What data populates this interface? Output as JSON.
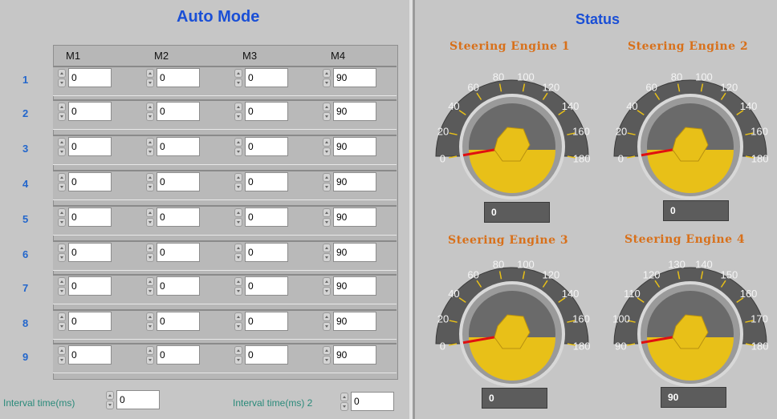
{
  "auto_mode": {
    "title": "Auto Mode",
    "columns": [
      "M1",
      "M2",
      "M3",
      "M4"
    ],
    "rows": [
      {
        "label": "1",
        "values": [
          "0",
          "0",
          "0",
          "90"
        ]
      },
      {
        "label": "2",
        "values": [
          "0",
          "0",
          "0",
          "90"
        ]
      },
      {
        "label": "3",
        "values": [
          "0",
          "0",
          "0",
          "90"
        ]
      },
      {
        "label": "4",
        "values": [
          "0",
          "0",
          "0",
          "90"
        ]
      },
      {
        "label": "5",
        "values": [
          "0",
          "0",
          "0",
          "90"
        ]
      },
      {
        "label": "6",
        "values": [
          "0",
          "0",
          "0",
          "90"
        ]
      },
      {
        "label": "7",
        "values": [
          "0",
          "0",
          "0",
          "90"
        ]
      },
      {
        "label": "8",
        "values": [
          "0",
          "0",
          "0",
          "90"
        ]
      },
      {
        "label": "9",
        "values": [
          "0",
          "0",
          "0",
          "90"
        ]
      }
    ],
    "interval1": {
      "label": "Interval time(ms)",
      "value": "0"
    },
    "interval2": {
      "label": "Interval time(ms) 2",
      "value": "0"
    }
  },
  "status": {
    "title": "Status",
    "gauges": [
      {
        "title": "Steering Engine 1",
        "ticks": [
          "0",
          "20",
          "40",
          "60",
          "80",
          "100",
          "120",
          "140",
          "160",
          "180"
        ],
        "min": 0,
        "max": 180,
        "value": 0,
        "readout": "0"
      },
      {
        "title": "Steering Engine 2",
        "ticks": [
          "0",
          "20",
          "40",
          "60",
          "80",
          "100",
          "120",
          "140",
          "160",
          "180"
        ],
        "min": 0,
        "max": 180,
        "value": 0,
        "readout": "0"
      },
      {
        "title": "Steering Engine 3",
        "ticks": [
          "0",
          "20",
          "40",
          "60",
          "80",
          "100",
          "120",
          "140",
          "160",
          "180"
        ],
        "min": 0,
        "max": 180,
        "value": 0,
        "readout": "0"
      },
      {
        "title": "Steering Engine 4",
        "ticks": [
          "90",
          "100",
          "110",
          "120",
          "130",
          "140",
          "150",
          "160",
          "170",
          "180"
        ],
        "min": 90,
        "max": 180,
        "value": 90,
        "readout": "90"
      }
    ]
  },
  "colors": {
    "title_blue": "#1a4fd6",
    "row_label_blue": "#2266cc",
    "gauge_title_orange": "#d8701a",
    "needle_red": "#e01010",
    "knob_yellow": "#e8c018",
    "interval_label_teal": "#2a8a7a"
  },
  "icons": [
    "spin-up-icon",
    "spin-down-icon",
    "gauge-knob-icon"
  ]
}
